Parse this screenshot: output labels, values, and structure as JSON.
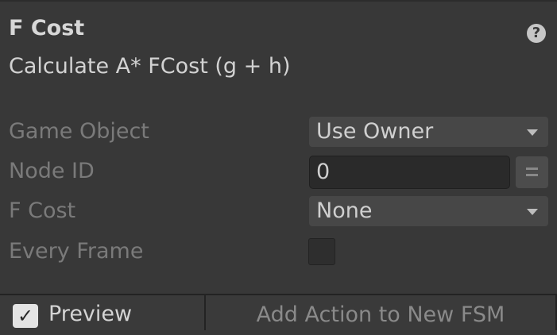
{
  "header": {
    "title": "F Cost",
    "help_icon": "question-circle-icon",
    "help_glyph": "?",
    "description": "Calculate A* FCost (g + h)"
  },
  "fields": {
    "game_object": {
      "label": "Game Object",
      "value": "Use Owner"
    },
    "node_id": {
      "label": "Node ID",
      "value": "0"
    },
    "f_cost": {
      "label": "F Cost",
      "value": "None"
    },
    "every_frame": {
      "label": "Every Frame",
      "checked": false
    }
  },
  "footer": {
    "preview_label": "Preview",
    "preview_checked": true,
    "preview_check_glyph": "✓",
    "add_action_label": "Add Action to New FSM"
  }
}
